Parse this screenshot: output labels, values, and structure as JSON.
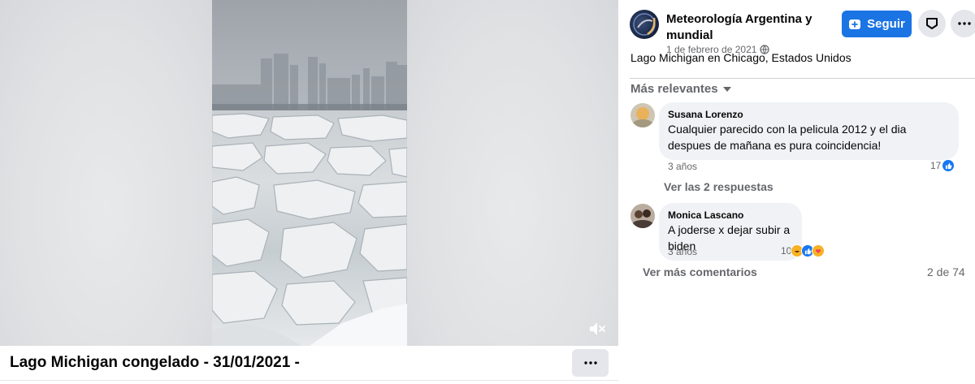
{
  "video": {
    "caption": "Lago Michigan congelado - 31/01/2021 -",
    "mute_icon": "speaker-muted-icon",
    "more_icon": "ellipsis-icon"
  },
  "page": {
    "name": "Meteorología Argentina y mundial",
    "date": "1 de febrero de 2021",
    "audience_icon": "globe-icon",
    "follow_label": "Seguir",
    "follow_icon": "add-page-icon",
    "save_icon": "save-bookmark-icon",
    "more_icon": "ellipsis-icon"
  },
  "post": {
    "text": "Lago Michigan en Chicago, Estados Unidos"
  },
  "comments": {
    "sort_label": "Más relevantes",
    "items": [
      {
        "author": "Susana Lorenzo",
        "text": "Cualquier parecido con la pelicula 2012 y el dia despues de mañana es pura coincidencia!",
        "time": "3 años",
        "reaction_count": "17",
        "reactions": [
          "like"
        ]
      },
      {
        "author": "Monica Lascano",
        "text": "A joderse x dejar subir a biden",
        "time": "3 años",
        "reaction_count": "10",
        "reactions": [
          "haha",
          "like",
          "care"
        ]
      }
    ],
    "replies_label": "Ver las 2 respuestas",
    "more_label": "Ver más comentarios",
    "count_label": "2 de 74"
  },
  "colors": {
    "accent": "#1b74e4",
    "secondary_text": "#65676b",
    "bubble": "#f0f2f5",
    "button_gray": "#e4e6eb"
  }
}
